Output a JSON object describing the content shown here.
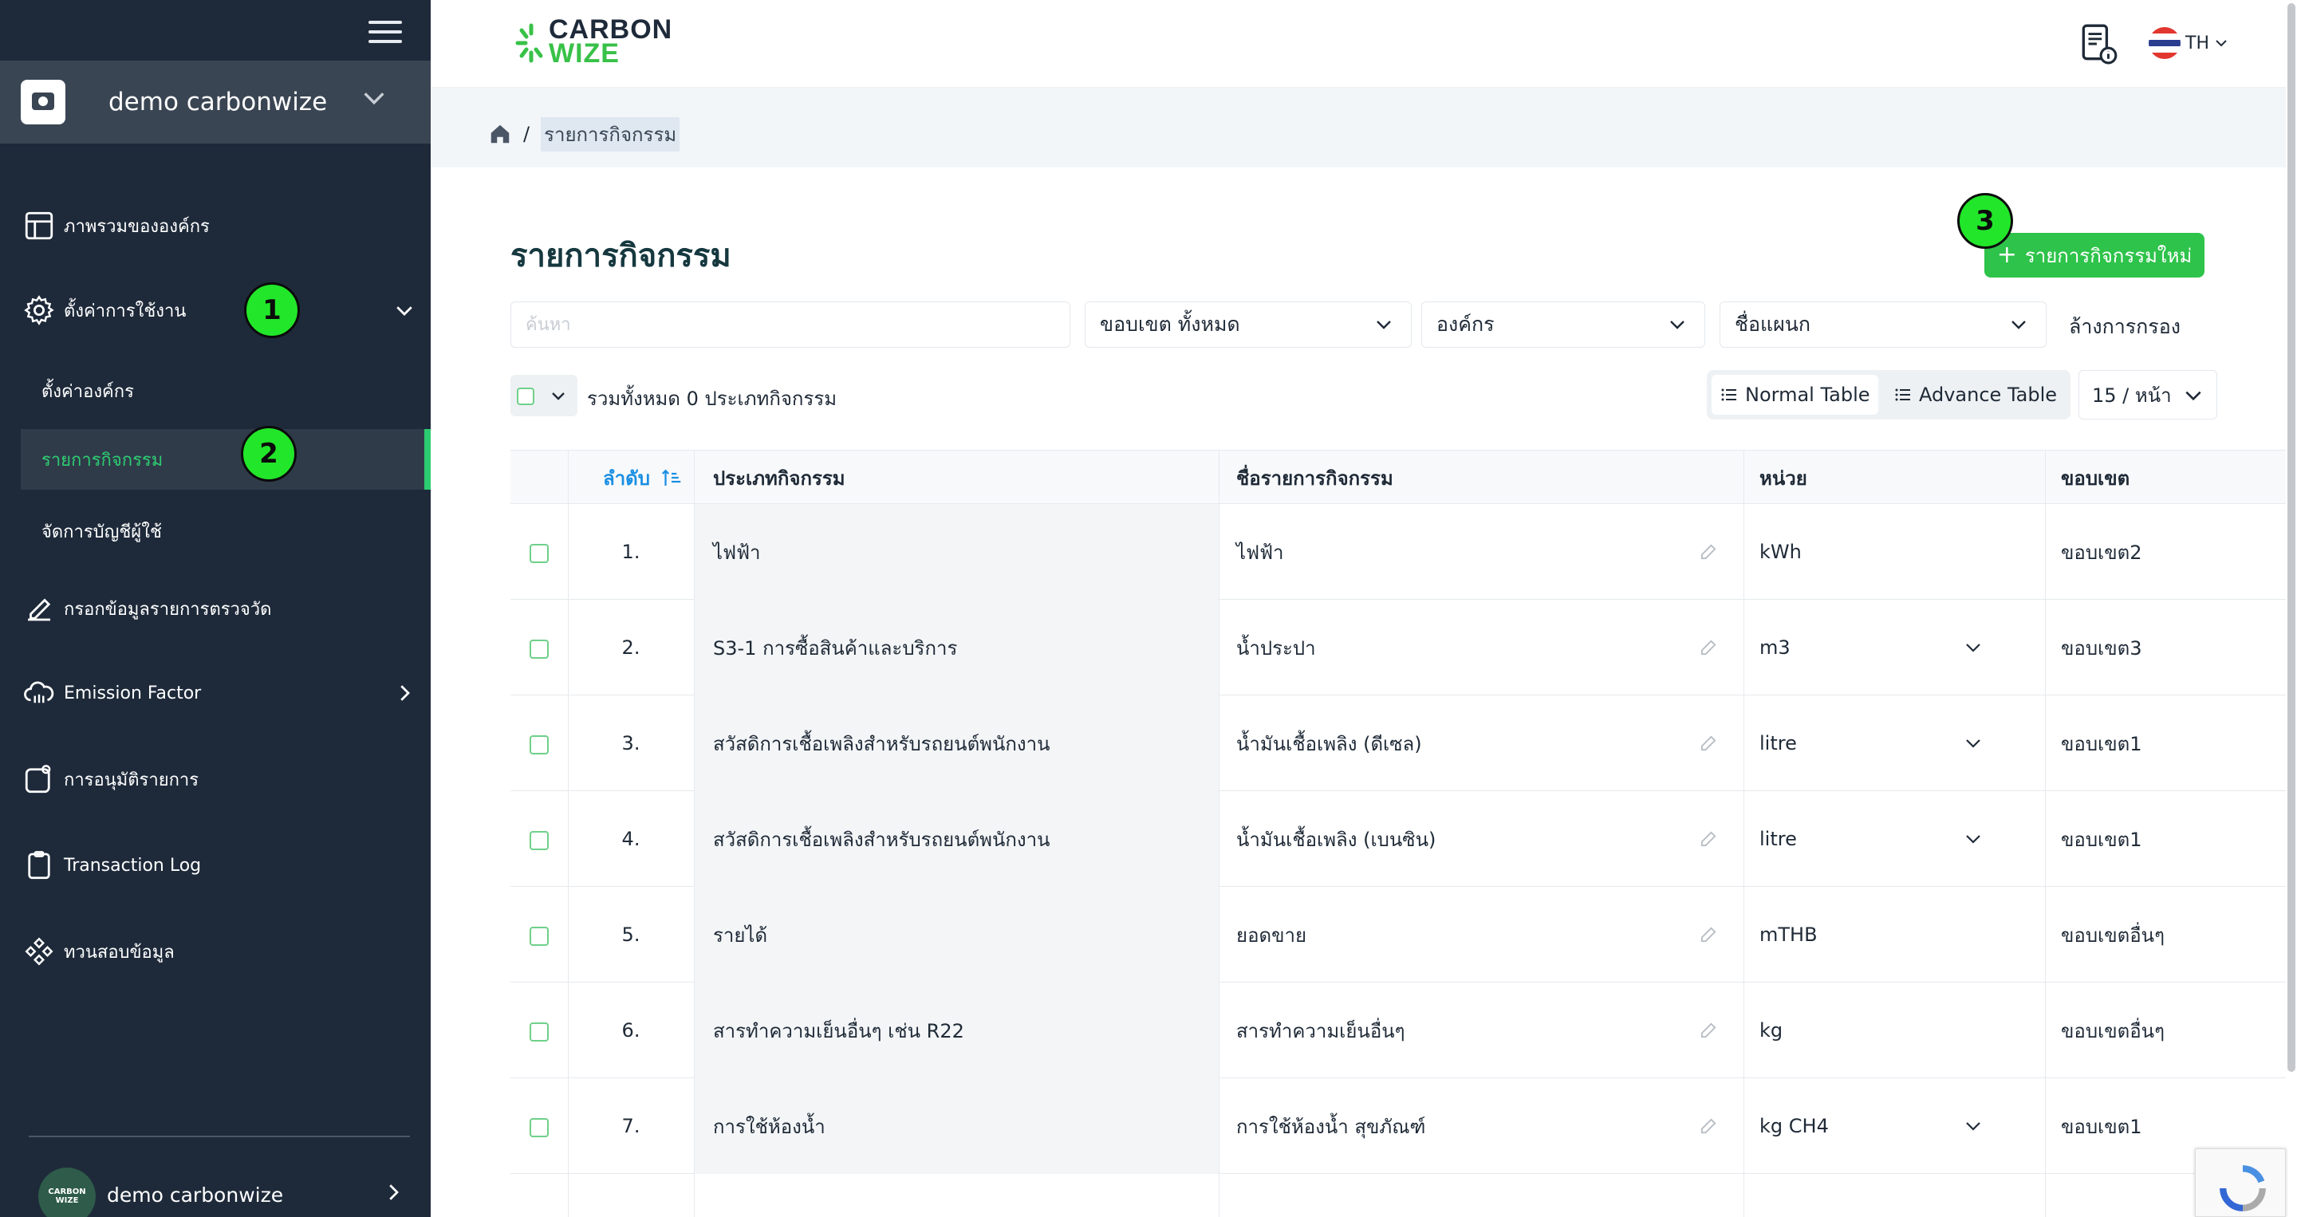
{
  "sidebar": {
    "org_name": "demo carbonwize",
    "items": [
      {
        "label": "ภาพรวมขององค์กร",
        "icon": "layout-icon"
      },
      {
        "label": "ตั้งค่าการใช้งาน",
        "icon": "gear-icon"
      },
      {
        "label": "กรอกข้อมูลรายการตรวจวัด",
        "icon": "pencil-icon"
      },
      {
        "label": "Emission Factor",
        "icon": "cloud-icon"
      },
      {
        "label": "การอนุมัติรายการ",
        "icon": "approval-icon"
      },
      {
        "label": "Transaction Log",
        "icon": "clipboard-icon"
      },
      {
        "label": "ทวนสอบข้อมูล",
        "icon": "verify-icon"
      }
    ],
    "sub_items": [
      {
        "label": "ตั้งค่าองค์กร"
      },
      {
        "label": "รายการกิจกรรม"
      },
      {
        "label": "จัดการบัญชีผู้ใช้"
      }
    ],
    "user_name": "demo carbonwize",
    "avatar_text": "CARBON WIZE"
  },
  "badges": [
    "1",
    "2",
    "3"
  ],
  "topbar": {
    "logo_line1": "CARBON",
    "logo_line2": "WIZE",
    "lang": "TH"
  },
  "breadcrumb": {
    "current": "รายการกิจกรรม"
  },
  "main": {
    "title": "รายการกิจกรรม",
    "new_button": "รายการกิจกรรมใหม่",
    "search_placeholder": "ค้นหา",
    "filters": {
      "scope": "ขอบเขต ทั้งหมด",
      "org": "องค์กร",
      "dept": "ชื่อแผนก",
      "clear": "ล้างการกรอง"
    },
    "total_text": "รวมทั้งหมด 0 ประเภทกิจกรรม",
    "view_normal": "Normal Table",
    "view_advance": "Advance Table",
    "per_page": "15 / หน้า"
  },
  "table": {
    "headers": {
      "order": "ลำดับ",
      "type": "ประเภทกิจกรรม",
      "name": "ชื่อรายการกิจกรรม",
      "unit": "หน่วย",
      "scope": "ขอบเขต"
    },
    "rows": [
      {
        "no": "1.",
        "type": "ไฟฟ้า",
        "name": "ไฟฟ้า",
        "unit": "kWh",
        "dropdown": false,
        "scope": "ขอบเขต2"
      },
      {
        "no": "2.",
        "type": "S3-1 การซื้อสินค้าและบริการ",
        "name": "น้ำประปา",
        "unit": "m3",
        "dropdown": true,
        "scope": "ขอบเขต3"
      },
      {
        "no": "3.",
        "type": "สวัสดิการเชื้อเพลิงสำหรับรถยนต์พนักงาน",
        "name": "น้ำมันเชื้อเพลิง (ดีเซล)",
        "unit": "litre",
        "dropdown": true,
        "scope": "ขอบเขต1"
      },
      {
        "no": "4.",
        "type": "สวัสดิการเชื้อเพลิงสำหรับรถยนต์พนักงาน",
        "name": "น้ำมันเชื้อเพลิง (เบนซิน)",
        "unit": "litre",
        "dropdown": true,
        "scope": "ขอบเขต1"
      },
      {
        "no": "5.",
        "type": "รายได้",
        "name": "ยอดขาย",
        "unit": "mTHB",
        "dropdown": false,
        "scope": "ขอบเขตอื่นๆ"
      },
      {
        "no": "6.",
        "type": "สารทำความเย็นอื่นๆ เช่น R22",
        "name": "สารทำความเย็นอื่นๆ",
        "unit": "kg",
        "dropdown": false,
        "scope": "ขอบเขตอื่นๆ"
      },
      {
        "no": "7.",
        "type": "การใช้ห้องน้ำ",
        "name": "การใช้ห้องน้ำ สุขภัณฑ์",
        "unit": "kg CH4",
        "dropdown": true,
        "scope": "ขอบเขต1"
      }
    ]
  },
  "colors": {
    "sidebar_bg": "#1e2a3a",
    "accent_green": "#2ec34a",
    "sort_blue": "#1a8fe3"
  }
}
